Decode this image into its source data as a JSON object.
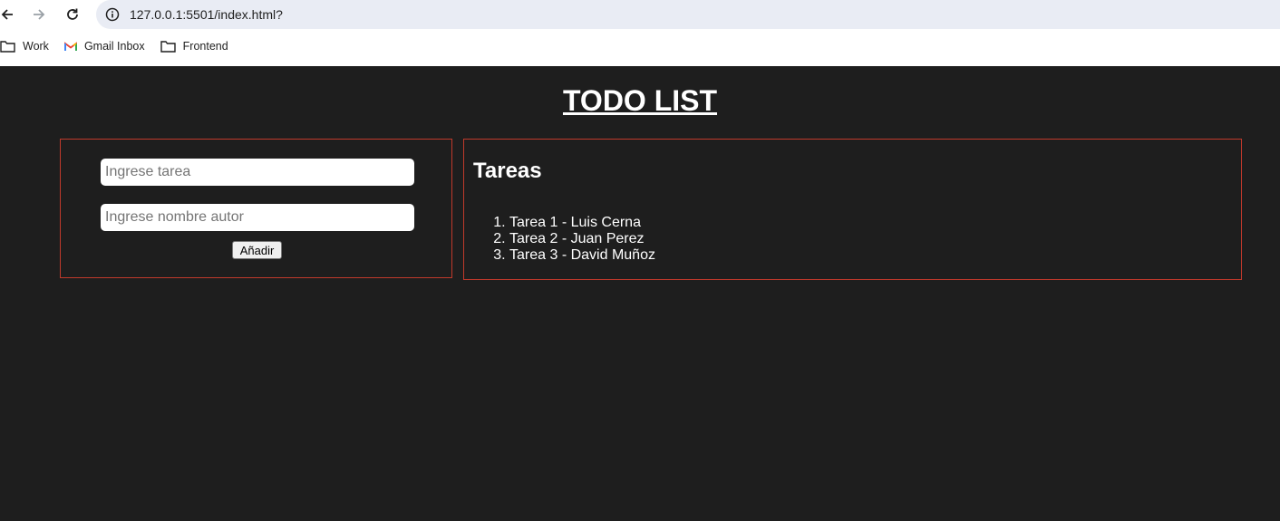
{
  "browser": {
    "url": "127.0.0.1:5501/index.html?",
    "nav_icons": [
      "back-arrow-icon",
      "forward-arrow-icon",
      "reload-icon",
      "site-info-icon"
    ],
    "bookmarks": [
      {
        "label": "Work",
        "icon": "folder-icon"
      },
      {
        "label": "Gmail Inbox",
        "icon": "gmail-icon"
      },
      {
        "label": "Frontend",
        "icon": "folder-icon"
      }
    ]
  },
  "page": {
    "title": "TODO LIST",
    "form": {
      "task_placeholder": "Ingrese tarea",
      "task_value": "",
      "author_placeholder": "Ingrese nombre autor",
      "author_value": "",
      "add_button_label": "Añadir"
    },
    "list": {
      "heading": "Tareas",
      "items": [
        "Tarea 1 - Luis Cerna",
        "Tarea 2 - Juan Perez",
        "Tarea 3 - David Muñoz"
      ]
    }
  },
  "colors": {
    "page_background": "#1e1e1e",
    "box_border": "#c0392b",
    "text": "#ffffff"
  }
}
